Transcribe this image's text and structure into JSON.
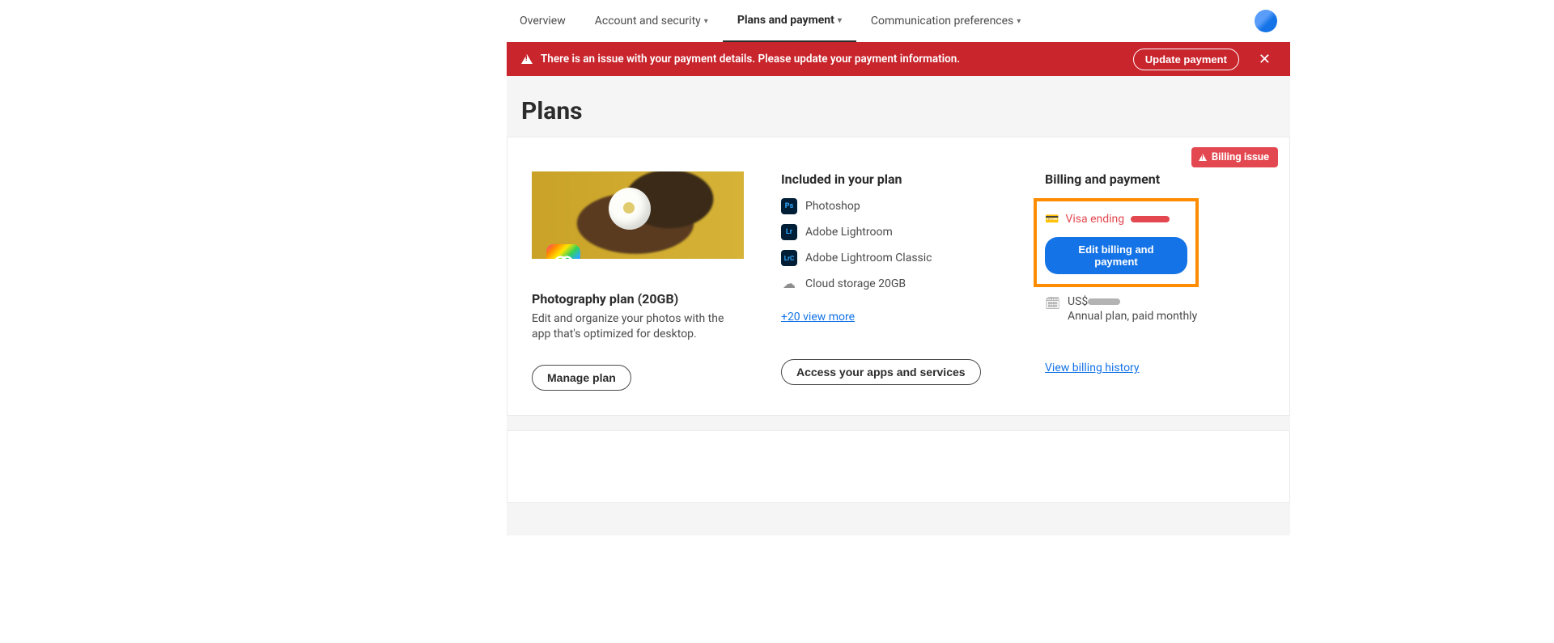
{
  "nav": {
    "overview": "Overview",
    "account": "Account and security",
    "plans": "Plans and payment",
    "comm": "Communication preferences"
  },
  "alert": {
    "message": "There is an issue with your payment details. Please update your payment information.",
    "button": "Update payment"
  },
  "page_title": "Plans",
  "badge": "Billing issue",
  "plan": {
    "name": "Photography plan (20GB)",
    "description": "Edit and organize your photos with the app that's optimized for desktop.",
    "manage_btn": "Manage plan"
  },
  "included": {
    "heading": "Included in your plan",
    "apps": {
      "ps": "Photoshop",
      "lr": "Adobe Lightroom",
      "lrc": "Adobe Lightroom Classic",
      "storage": "Cloud storage 20GB"
    },
    "view_more": "+20 view more",
    "access_btn": "Access your apps and services"
  },
  "billing": {
    "heading": "Billing and payment",
    "visa_prefix": "Visa ending",
    "edit_btn": "Edit billing and payment",
    "price_prefix": "US$",
    "term": "Annual plan, paid monthly",
    "history_link": "View billing history"
  }
}
